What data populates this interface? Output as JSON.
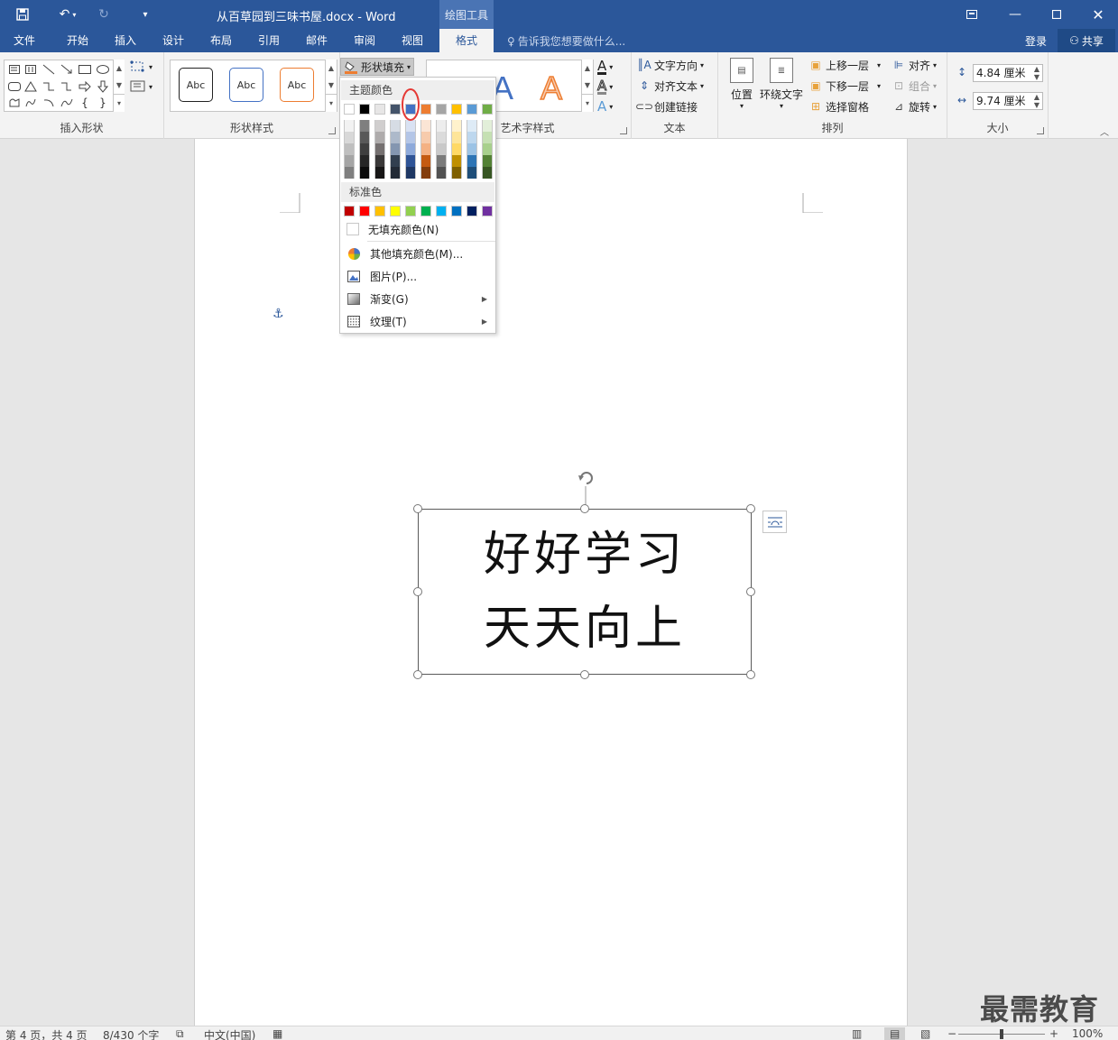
{
  "titlebar": {
    "doc_title": "从百草园到三味书屋.docx - Word",
    "contextual_tools": "绘图工具",
    "colors": {
      "bar": "#2b579a",
      "accent": "#2b579a"
    }
  },
  "tabs": [
    {
      "label": "文件"
    },
    {
      "label": "开始"
    },
    {
      "label": "插入"
    },
    {
      "label": "设计"
    },
    {
      "label": "布局"
    },
    {
      "label": "引用"
    },
    {
      "label": "邮件"
    },
    {
      "label": "审阅"
    },
    {
      "label": "视图"
    },
    {
      "label": "格式"
    }
  ],
  "active_tab": "格式",
  "tellme": "告诉我您想要做什么...",
  "account": {
    "login": "登录",
    "share": "共享"
  },
  "ribbon": {
    "groups": {
      "insert_shapes": "插入形状",
      "shape_styles": "形状样式",
      "wordart_styles": "艺术字样式",
      "text": "文本",
      "arrange": "排列",
      "size": "大小"
    },
    "shape_style_preview": "Abc",
    "shape_fill": "形状填充",
    "text_direction": "文字方向",
    "align_text": "对齐文本",
    "create_link": "创建链接",
    "position": "位置",
    "wrap_text": "环绕文字",
    "bring_forward": "上移一层",
    "send_backward": "下移一层",
    "selection_pane": "选择窗格",
    "align": "对齐",
    "group": "组合",
    "rotate": "旋转",
    "height": "4.84 厘米",
    "width": "9.74 厘米"
  },
  "fill_menu": {
    "theme_colors_label": "主题颜色",
    "standard_colors_label": "标准色",
    "theme_top": [
      "#ffffff",
      "#000000",
      "#e7e6e6",
      "#44546a",
      "#4472c4",
      "#ed7d31",
      "#a5a5a5",
      "#ffc000",
      "#5b9bd5",
      "#70ad47"
    ],
    "theme_shades": [
      [
        "#f2f2f2",
        "#7f7f7f",
        "#d0cece",
        "#d6dce4",
        "#d9e2f3",
        "#fbe5d5",
        "#ededed",
        "#fff2cc",
        "#deebf6",
        "#e2efd9"
      ],
      [
        "#d8d8d8",
        "#595959",
        "#aeabab",
        "#adb9ca",
        "#b4c6e7",
        "#f7cbac",
        "#dbdbdb",
        "#fee599",
        "#bdd7ee",
        "#c5e0b3"
      ],
      [
        "#bfbfbf",
        "#3f3f3f",
        "#757070",
        "#8496b0",
        "#8eaadb",
        "#f4b183",
        "#c9c9c9",
        "#ffd965",
        "#9cc3e5",
        "#a8d08d"
      ],
      [
        "#a5a5a5",
        "#262626",
        "#3a3838",
        "#323f4f",
        "#2f5496",
        "#c55a11",
        "#7b7b7b",
        "#bf8f00",
        "#2e75b5",
        "#538135"
      ],
      [
        "#7f7f7f",
        "#0c0c0c",
        "#171616",
        "#222a35",
        "#1f3864",
        "#833c0b",
        "#525252",
        "#7f6000",
        "#1e4e79",
        "#375623"
      ]
    ],
    "standard": [
      "#c00000",
      "#ff0000",
      "#ffc000",
      "#ffff00",
      "#92d050",
      "#00b050",
      "#00b0f0",
      "#0070c0",
      "#002060",
      "#7030a0"
    ],
    "no_fill": "无填充颜色(N)",
    "more_colors": "其他填充颜色(M)...",
    "picture": "图片(P)...",
    "gradient": "渐变(G)",
    "texture": "纹理(T)",
    "highlight_color": "#e53935"
  },
  "document": {
    "line1": "好好学习",
    "line2": "天天向上"
  },
  "status": {
    "page": "第 4 页，共 4 页",
    "words": "8/430 个字",
    "language": "中文(中国)",
    "zoom": "100%"
  },
  "watermark": "最需教育"
}
